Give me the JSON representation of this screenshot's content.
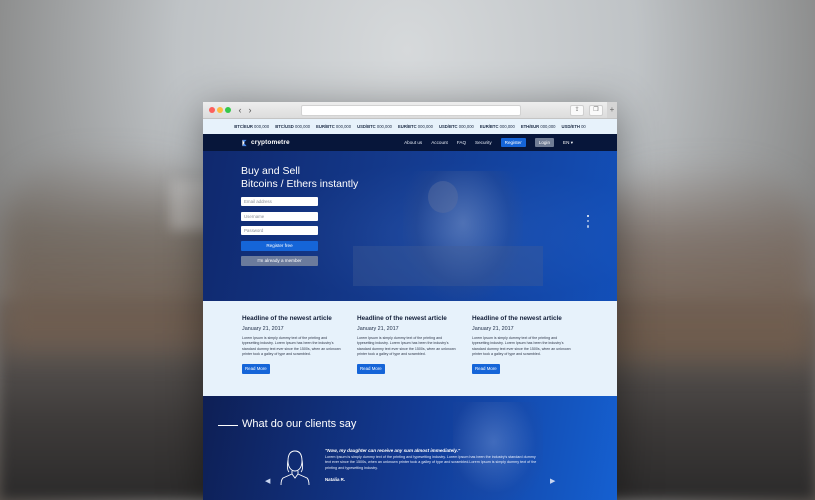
{
  "ticker": [
    {
      "pair": "BTC/EUR",
      "value": "000,000"
    },
    {
      "pair": "BTC/USD",
      "value": "000,000"
    },
    {
      "pair": "EUR/BTC",
      "value": "000,000"
    },
    {
      "pair": "USD/BTC",
      "value": "000,000"
    },
    {
      "pair": "EUR/BTC",
      "value": "000,000"
    },
    {
      "pair": "USD/BTC",
      "value": "000,000"
    },
    {
      "pair": "EUR/BTC",
      "value": "000,000"
    },
    {
      "pair": "ETH/EUR",
      "value": "000,000"
    },
    {
      "pair": "USD/ETH",
      "value": "00"
    }
  ],
  "nav": {
    "logo": "cryptometre",
    "menu": [
      "About us",
      "Account",
      "FAQ",
      "Security"
    ],
    "register": "Register",
    "login": "Login",
    "lang": "EN"
  },
  "hero": {
    "title_line1": "Buy and Sell",
    "title_line2": "Bitcoins / Ethers instantly",
    "email_placeholder": "Email address",
    "username_placeholder": "Username",
    "password_placeholder": "Password",
    "register_free": "Register free",
    "already_member": "I'm already a member"
  },
  "articles": [
    {
      "headline": "Headline of the newest article",
      "date": "January 21, 2017",
      "body": "Lorem Ipsum is simply dummy text of the printing and typesetting industry. Lorem Ipsum has been the industry's standard dummy text ever since the 1500s, when an unknown printer took a galley of type and scrambled.",
      "button": "Read More"
    },
    {
      "headline": "Headline of the newest article",
      "date": "January 21, 2017",
      "body": "Lorem Ipsum is simply dummy text of the printing and typesetting industry. Lorem Ipsum has been the industry's standard dummy text ever since the 1500s, when an unknown printer took a galley of type and scrambled.",
      "button": "Read More"
    },
    {
      "headline": "Headline of the newest article",
      "date": "January 21, 2017",
      "body": "Lorem Ipsum is simply dummy text of the printing and typesetting industry. Lorem Ipsum has been the industry's standard dummy text ever since the 1500s, when an unknown printer took a galley of type and scrambled.",
      "button": "Read More"
    }
  ],
  "testimonials": {
    "title": "What do our clients say",
    "quote": "\"Now, my daughter can receive any sum almost immediately.\"",
    "body": "Lorem Ipsum is simply dummy text of the printing and typesetting industry. Lorem Ipsum has been the industry's standard dummy text ever since the 1500s, when an unknown printer took a galley of type and scrambled.Lorem Ipsum is simply dummy text of the printing and typesetting industry.",
    "name": "Natalia R.",
    "prev_icon": "chevron-left-icon",
    "next_icon": "chevron-right-icon"
  },
  "colors": {
    "primary": "#1565d8",
    "navy": "#07163a",
    "light_bg": "#e7f2fb"
  }
}
